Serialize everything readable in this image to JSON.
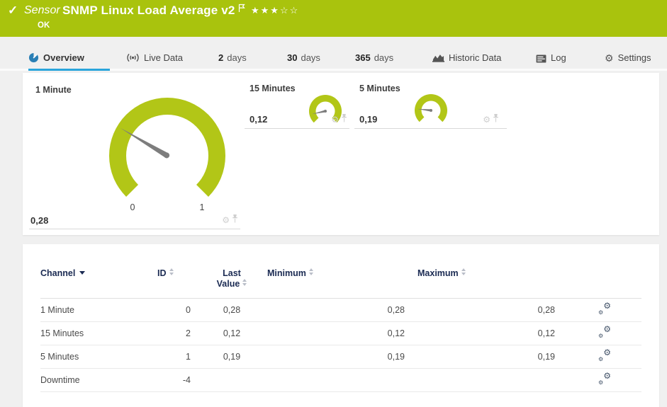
{
  "header": {
    "check": "✓",
    "kind": "Sensor",
    "title": "SNMP Linux Load Average v2",
    "status": "OK",
    "stars_filled": 3,
    "stars_total": 5
  },
  "tabs": {
    "overview": {
      "label": "Overview",
      "active": true
    },
    "live": {
      "label": "Live Data"
    },
    "days2": {
      "num": "2",
      "unit": "days"
    },
    "days30": {
      "num": "30",
      "unit": "days"
    },
    "days365": {
      "num": "365",
      "unit": "days"
    },
    "historic": {
      "label": "Historic Data"
    },
    "log": {
      "label": "Log"
    },
    "settings": {
      "label": "Settings"
    }
  },
  "gauges": {
    "primary": {
      "title": "1 Minute",
      "value": "0,28",
      "value_num": 0.28,
      "min_label": "0",
      "max_label": "1",
      "range": [
        0,
        1
      ]
    },
    "minis": [
      {
        "title": "15 Minutes",
        "value": "0,12",
        "value_num": 0.12,
        "range": [
          0,
          1
        ]
      },
      {
        "title": "5 Minutes",
        "value": "0,19",
        "value_num": 0.19,
        "range": [
          0,
          1
        ]
      }
    ]
  },
  "table": {
    "columns": {
      "channel": {
        "label": "Channel",
        "sorted": "desc"
      },
      "id": {
        "label": "ID"
      },
      "last": {
        "line1": "Last",
        "line2": "Value"
      },
      "min": {
        "label": "Minimum"
      },
      "max": {
        "label": "Maximum"
      }
    },
    "rows": [
      {
        "channel": "1 Minute",
        "id": "0",
        "last": "0,28",
        "min": "0,28",
        "max": "0,28"
      },
      {
        "channel": "15 Minutes",
        "id": "2",
        "last": "0,12",
        "min": "0,12",
        "max": "0,12"
      },
      {
        "channel": "5 Minutes",
        "id": "1",
        "last": "0,19",
        "min": "0,19",
        "max": "0,19"
      },
      {
        "channel": "Downtime",
        "id": "-4",
        "last": "",
        "min": "",
        "max": ""
      }
    ]
  },
  "colors": {
    "header_green": "#a9c30d",
    "gauge_green": "#b2c617",
    "tab_active_blue": "#2aa5dc",
    "overview_icon_blue": "#2a7fb5",
    "table_header_navy": "#1a2a52",
    "needle_gray": "#7d7d7d",
    "panel_bg": "#ffffff",
    "page_bg": "#f0f0f0"
  }
}
